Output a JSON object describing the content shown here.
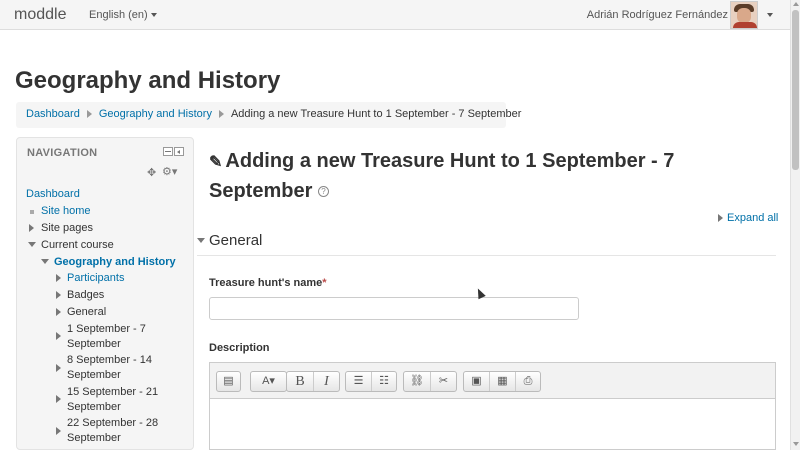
{
  "topbar": {
    "brand": "moddle",
    "language": "English (en)",
    "user_name": "Adrián Rodríguez Fernández"
  },
  "page": {
    "title": "Geography and History"
  },
  "breadcrumb": {
    "items": [
      "Dashboard",
      "Geography and History",
      "Adding a new Treasure Hunt to 1 September - 7 September"
    ]
  },
  "navigation": {
    "header": "NAVIGATION",
    "items": [
      {
        "label": "Dashboard"
      },
      {
        "label": "Site home"
      },
      {
        "label": "Site pages"
      },
      {
        "label": "Current course"
      },
      {
        "label": "Geography and History"
      },
      {
        "label": "Participants"
      },
      {
        "label": "Badges"
      },
      {
        "label": "General"
      },
      {
        "label_line1": "1 September - 7",
        "label_line2": "September"
      },
      {
        "label_line1": "8 September - 14",
        "label_line2": "September"
      },
      {
        "label_line1": "15 September - 21",
        "label_line2": "September"
      },
      {
        "label_line1": "22 September - 28",
        "label_line2": "September"
      }
    ]
  },
  "main": {
    "heading": "Adding a new Treasure Hunt to 1 September - 7 September",
    "expand_all": "Expand all",
    "section_general": "General",
    "name_label": "Treasure hunt's name",
    "required_mark": "*",
    "name_value": "",
    "description_label": "Description"
  },
  "editor": {
    "toolbar_icons": [
      "toggle-toolbar-icon",
      "font-size-icon",
      "bold-icon",
      "italic-icon",
      "unordered-list-icon",
      "ordered-list-icon",
      "link-icon",
      "unlink-icon",
      "image-icon",
      "media-icon",
      "manage-files-icon"
    ],
    "bold_glyph": "B",
    "italic_glyph": "I"
  },
  "colors": {
    "link": "#0070a8",
    "required": "#b94a48",
    "panel_bg": "#f5f5f5"
  }
}
